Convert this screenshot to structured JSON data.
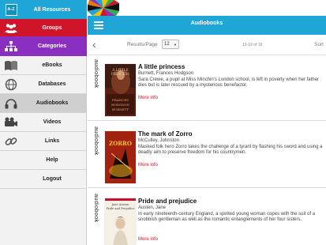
{
  "sidebar": {
    "az_badge": "A-Z",
    "all_resources": "All Resources",
    "groups": "Groups",
    "categories": "Categories",
    "items": [
      {
        "label": "eBooks",
        "icon": "book-icon"
      },
      {
        "label": "Databases",
        "icon": "globe-icon"
      },
      {
        "label": "Audiobooks",
        "icon": "headphones-icon",
        "active": true
      },
      {
        "label": "Videos",
        "icon": "video-camera-icon"
      },
      {
        "label": "Links",
        "icon": "chain-link-icon"
      },
      {
        "label": "Help",
        "icon": ""
      },
      {
        "label": "Logout",
        "icon": ""
      }
    ]
  },
  "header": {
    "title": "Audiobooks"
  },
  "toolbar": {
    "results_per_page_label": "Results/Page",
    "results_per_page_value": "12",
    "page_info": "13-19 of 19",
    "sort_label": "Sort"
  },
  "results": [
    {
      "format": "audiobook",
      "title": "A little princess",
      "author": "Burnett, Frances Hodgson",
      "description": "Sara Crewe, a pupil at Miss Minchin's London school, is left in poverty when her father dies but is later rescued by a mysterious benefactor.",
      "more": "More info",
      "cover_text": [
        "A LITTLE",
        "PRINCESS",
        "FRANCES",
        "HODGSON",
        "BURNETT"
      ]
    },
    {
      "format": "audiobook",
      "title": "The mark of Zorro",
      "author": "McCulley, Johnston",
      "description": "Masked folk hero Zorro takes the challenge of a tyrant by flashing his sword and using a deadly aim to preserve freedom for his countrymen.",
      "more": "More info",
      "cover_text": [
        "ZORRO"
      ]
    },
    {
      "format": "audiobook",
      "title": "Pride and prejudice",
      "author": "Austen, Jane",
      "description": "In early nineteenth-century England, a spirited young woman copes with the suit of a snobbish gentleman as well as the romantic entanglements of her four sisters.",
      "more": "More info",
      "cover_text": [
        "Jane Austen",
        "Pride and Prejudice"
      ]
    }
  ],
  "colors": {
    "header_blue": "#1fa5d6",
    "groups_red": "#d0142a",
    "categories_purple": "#8b2fc0",
    "more_info_red": "#d0142a"
  }
}
